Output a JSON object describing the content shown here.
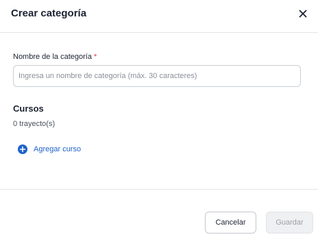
{
  "dialog": {
    "title": "Crear categoría",
    "close_icon": "close-icon"
  },
  "form": {
    "name_label": "Nombre de la categoría",
    "required_mark": "*",
    "name_placeholder": "Ingresa un nombre de categoría (máx. 30 caracteres)",
    "name_value": ""
  },
  "courses": {
    "title": "Cursos",
    "count_text": "0 trayecto(s)",
    "add_label": "Agregar curso",
    "add_icon": "plus-circle-icon"
  },
  "footer": {
    "cancel_label": "Cancelar",
    "save_label": "Guardar"
  },
  "colors": {
    "accent": "#1e62c9",
    "required": "#e0364a",
    "disabled_bg": "#eff0f2",
    "disabled_text": "#9aa0a8"
  }
}
